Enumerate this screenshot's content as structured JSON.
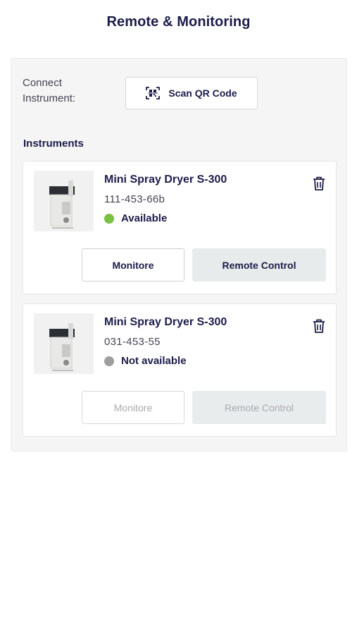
{
  "header": {
    "title": "Remote & Monitoring"
  },
  "connect": {
    "label": "Connect Instrument:",
    "scan_button_label": "Scan QR Code",
    "scan_icon": "qr-scan-icon"
  },
  "instruments": {
    "section_title": "Instruments",
    "items": [
      {
        "name": "Mini Spray Dryer S-300",
        "serial": "111-453-66b",
        "status": "Available",
        "status_color": "#7ac143",
        "monitor_label": "Monitore",
        "remote_label": "Remote Control",
        "delete_icon": "trash-icon",
        "enabled": true
      },
      {
        "name": "Mini Spray Dryer S-300",
        "serial": "031-453-55",
        "status": "Not available",
        "status_color": "#9e9e9e",
        "monitor_label": "Monitore",
        "remote_label": "Remote Control",
        "delete_icon": "trash-icon",
        "enabled": false
      }
    ]
  }
}
